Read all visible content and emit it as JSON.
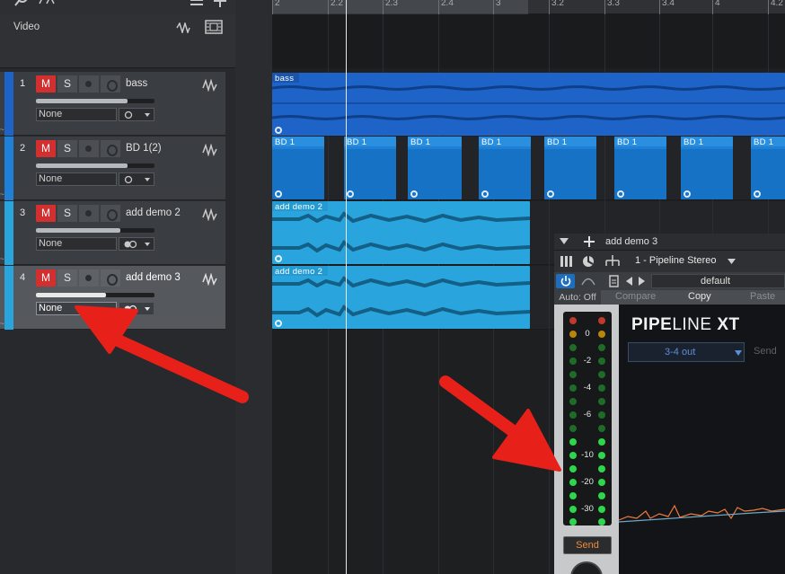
{
  "video_track": {
    "label": "Video"
  },
  "tracks": [
    {
      "number": "1",
      "mute": "M",
      "solo": "S",
      "name": "bass",
      "input": "None",
      "color": "#1e63c8",
      "volume": 0.77
    },
    {
      "number": "2",
      "mute": "M",
      "solo": "S",
      "name": "BD 1(2)",
      "input": "None",
      "color": "#1e80d6",
      "volume": 0.77
    },
    {
      "number": "3",
      "mute": "M",
      "solo": "S",
      "name": "add demo 2",
      "input": "None",
      "color": "#29a4dc",
      "volume": 0.71
    },
    {
      "number": "4",
      "mute": "M",
      "solo": "S",
      "name": "add demo 3",
      "input": "None",
      "color": "#29a4dc",
      "volume": 0.59
    }
  ],
  "ruler": {
    "labels": [
      "2",
      "2.2",
      "2.3",
      "2.4",
      "3",
      "3.2",
      "3.3",
      "3.4",
      "4",
      "4.2"
    ]
  },
  "clips": {
    "bass": "bass",
    "bd": [
      "BD 1",
      "BD 1",
      "BD 1",
      "BD 1",
      "BD 1",
      "BD 1",
      "BD 1",
      "BD 1"
    ],
    "demo2": "add demo 2",
    "demo3": "add demo 2"
  },
  "plugin": {
    "title": "add demo 3",
    "preset_channel": "1 - Pipeline Stereo",
    "preset_name": "default",
    "auto": "Auto: Off",
    "compare": "Compare",
    "copy": "Copy",
    "paste": "Paste",
    "meter_labels": [
      "0",
      "-2",
      "-4",
      "-6",
      "-10",
      "-20",
      "-30"
    ],
    "send_button": "Send",
    "pipeline_title_bold1": "PIPE",
    "pipeline_title_light": "LINE",
    "pipeline_title_bold2": "XT",
    "output_select": "3-4 out",
    "output_send": "Send"
  },
  "colors": {
    "mute": "#d32f2f",
    "bass_clip": "#1e63c8",
    "bd_clip": "#1e80d6",
    "demo_clip": "#29a4dc",
    "arrow": "#e8201a",
    "send_text": "#f08a3c"
  }
}
